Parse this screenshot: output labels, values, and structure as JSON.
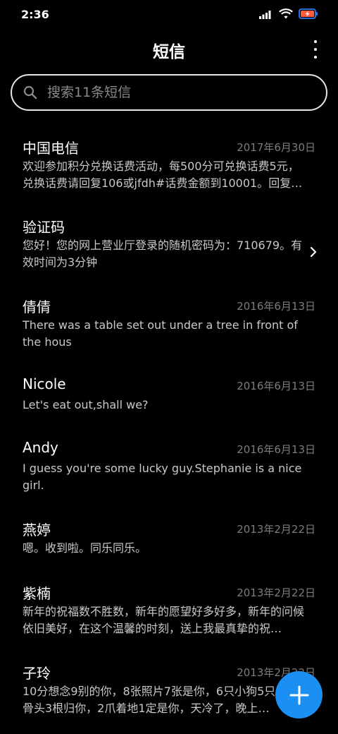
{
  "status_bar": {
    "time": "2:36"
  },
  "header": {
    "title": "短信"
  },
  "search": {
    "placeholder": "搜索11条短信"
  },
  "messages": [
    {
      "name": "中国电信",
      "date": "2017年6月30日",
      "preview": "欢迎参加积分兑换话费活动，每500分可兑换话费5元，兑换话费请回复106或jfdh#话费金额到10001。回复…"
    },
    {
      "name": "验证码",
      "date": "",
      "preview": "您好！您的网上营业厅登录的随机密码为：710679。有效时间为3分钟"
    },
    {
      "name": "倩倩",
      "date": "2016年6月13日",
      "preview": "There was a table set out under a tree in front of the hous"
    },
    {
      "name": "Nicole",
      "date": "2016年6月13日",
      "preview": "Let's eat out,shall we?"
    },
    {
      "name": "Andy",
      "date": "2016年6月13日",
      "preview": "I guess you're some lucky guy.Stephanie is a nice girl."
    },
    {
      "name": "燕婷",
      "date": "2013年2月22日",
      "preview": "嗯。收到啦。同乐同乐。"
    },
    {
      "name": "紫楠",
      "date": "2013年2月22日",
      "preview": "新年的祝福数不胜数，新年的愿望好多好多，新年的问候依旧美好，在这个温馨的时刻，送上我最真挚的祝…"
    },
    {
      "name": "子玲",
      "date": "2013年2月22日",
      "preview": "10分想念9别的你，8张照片7张是你，6只小狗5只4根骨头3根归你，2爪着地1定是你，天冷了，晚上…"
    }
  ],
  "icons": {
    "signal": "signal-icon",
    "wifi": "wifi-icon",
    "battery": "battery-charging-icon",
    "more": "more-vertical-icon",
    "search": "search-icon",
    "chevron": "chevron-right-icon",
    "compose": "plus-icon"
  },
  "colors": {
    "background": "#000000",
    "accent": "#1c8ff2",
    "battery": "#ff5a3c"
  }
}
